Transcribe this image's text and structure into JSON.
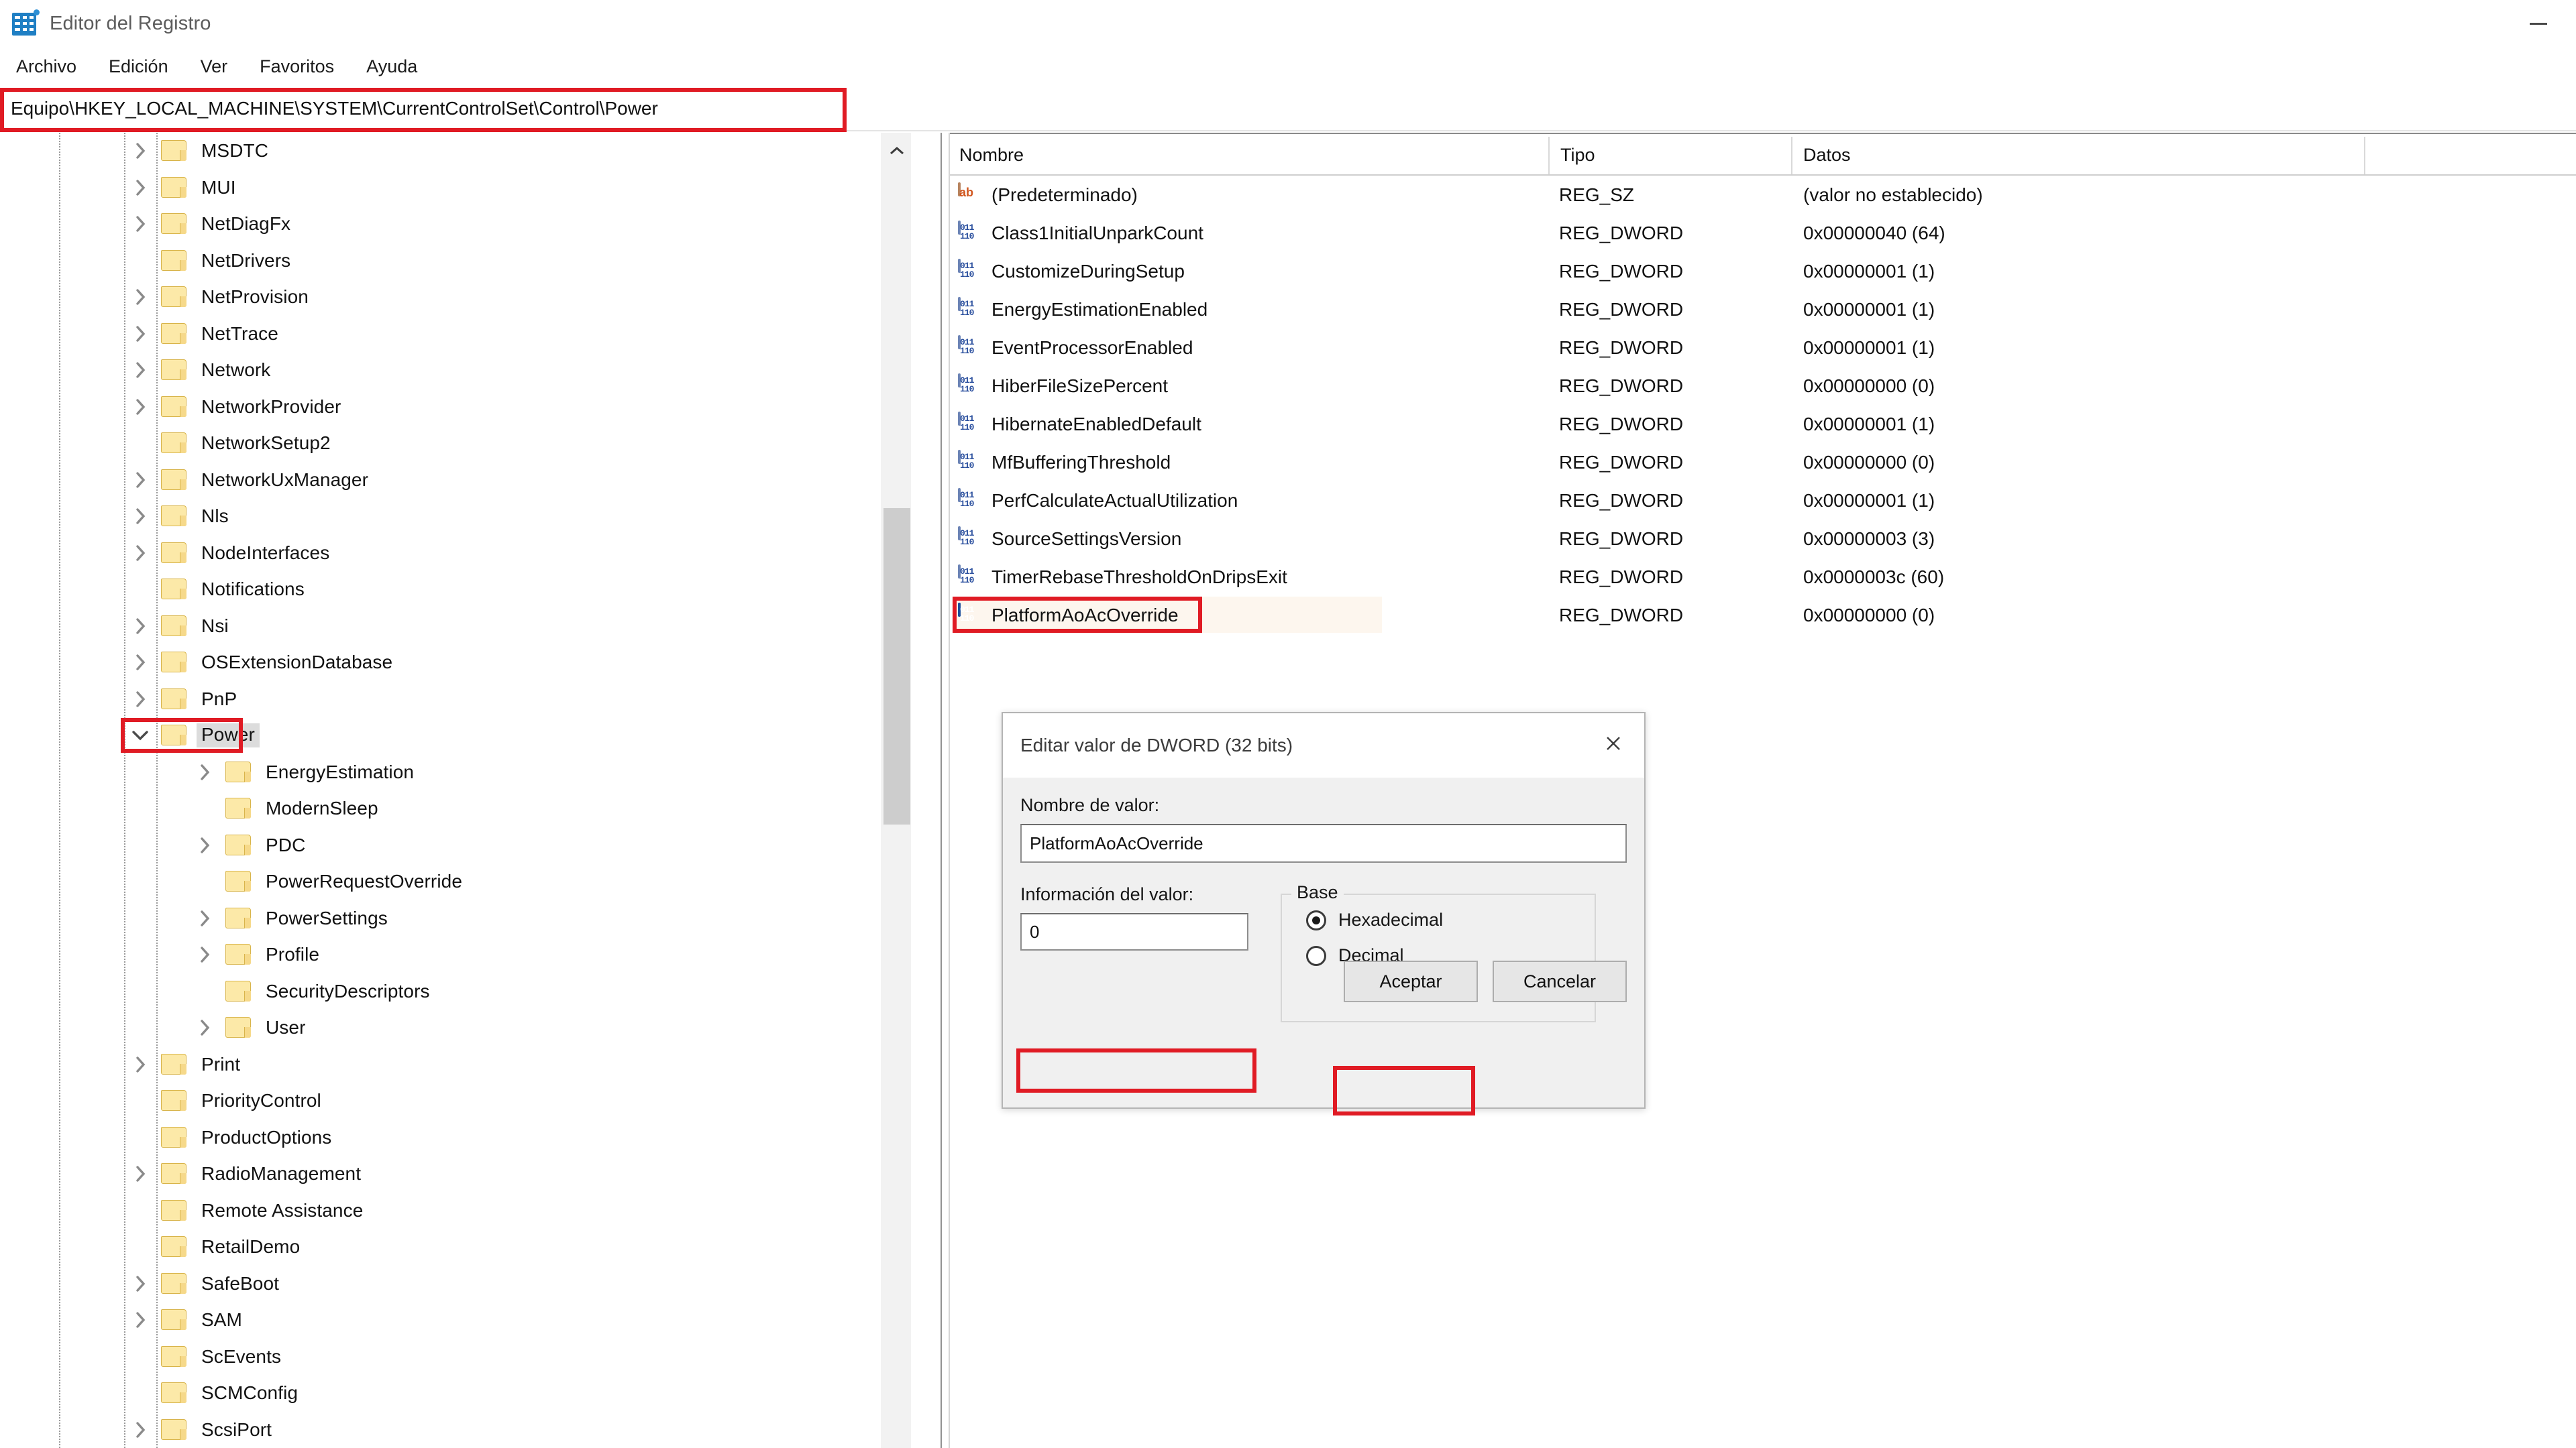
{
  "window": {
    "title": "Editor del Registro",
    "app_icon": "registry-editor-icon",
    "minimize_label": "Minimizar"
  },
  "menubar": {
    "items": [
      {
        "label": "Archivo"
      },
      {
        "label": "Edición"
      },
      {
        "label": "Ver"
      },
      {
        "label": "Favoritos"
      },
      {
        "label": "Ayuda"
      }
    ]
  },
  "address_bar": {
    "value": "Equipo\\HKEY_LOCAL_MACHINE\\SYSTEM\\CurrentControlSet\\Control\\Power",
    "highlighted": true,
    "highlight_color": "#e01b24"
  },
  "tree": {
    "scroll_arrow_up_icon": "chevron-up-icon",
    "nodes": [
      {
        "label": "MSDTC",
        "depth": 1,
        "expandable": true,
        "expanded": false
      },
      {
        "label": "MUI",
        "depth": 1,
        "expandable": true,
        "expanded": false
      },
      {
        "label": "NetDiagFx",
        "depth": 1,
        "expandable": true,
        "expanded": false
      },
      {
        "label": "NetDrivers",
        "depth": 1,
        "expandable": false,
        "expanded": false
      },
      {
        "label": "NetProvision",
        "depth": 1,
        "expandable": true,
        "expanded": false
      },
      {
        "label": "NetTrace",
        "depth": 1,
        "expandable": true,
        "expanded": false
      },
      {
        "label": "Network",
        "depth": 1,
        "expandable": true,
        "expanded": false
      },
      {
        "label": "NetworkProvider",
        "depth": 1,
        "expandable": true,
        "expanded": false
      },
      {
        "label": "NetworkSetup2",
        "depth": 1,
        "expandable": false,
        "expanded": false
      },
      {
        "label": "NetworkUxManager",
        "depth": 1,
        "expandable": true,
        "expanded": false
      },
      {
        "label": "Nls",
        "depth": 1,
        "expandable": true,
        "expanded": false
      },
      {
        "label": "NodeInterfaces",
        "depth": 1,
        "expandable": true,
        "expanded": false
      },
      {
        "label": "Notifications",
        "depth": 1,
        "expandable": false,
        "expanded": false
      },
      {
        "label": "Nsi",
        "depth": 1,
        "expandable": true,
        "expanded": false
      },
      {
        "label": "OSExtensionDatabase",
        "depth": 1,
        "expandable": true,
        "expanded": false
      },
      {
        "label": "PnP",
        "depth": 1,
        "expandable": true,
        "expanded": false
      },
      {
        "label": "Power",
        "depth": 1,
        "expandable": true,
        "expanded": true,
        "selected": true,
        "highlighted": true
      },
      {
        "label": "EnergyEstimation",
        "depth": 2,
        "expandable": true,
        "expanded": false
      },
      {
        "label": "ModernSleep",
        "depth": 2,
        "expandable": false,
        "expanded": false
      },
      {
        "label": "PDC",
        "depth": 2,
        "expandable": true,
        "expanded": false
      },
      {
        "label": "PowerRequestOverride",
        "depth": 2,
        "expandable": false,
        "expanded": false
      },
      {
        "label": "PowerSettings",
        "depth": 2,
        "expandable": true,
        "expanded": false
      },
      {
        "label": "Profile",
        "depth": 2,
        "expandable": true,
        "expanded": false
      },
      {
        "label": "SecurityDescriptors",
        "depth": 2,
        "expandable": false,
        "expanded": false
      },
      {
        "label": "User",
        "depth": 2,
        "expandable": true,
        "expanded": false
      },
      {
        "label": "Print",
        "depth": 1,
        "expandable": true,
        "expanded": false
      },
      {
        "label": "PriorityControl",
        "depth": 1,
        "expandable": false,
        "expanded": false
      },
      {
        "label": "ProductOptions",
        "depth": 1,
        "expandable": false,
        "expanded": false
      },
      {
        "label": "RadioManagement",
        "depth": 1,
        "expandable": true,
        "expanded": false
      },
      {
        "label": "Remote Assistance",
        "depth": 1,
        "expandable": false,
        "expanded": false
      },
      {
        "label": "RetailDemo",
        "depth": 1,
        "expandable": false,
        "expanded": false
      },
      {
        "label": "SafeBoot",
        "depth": 1,
        "expandable": true,
        "expanded": false
      },
      {
        "label": "SAM",
        "depth": 1,
        "expandable": true,
        "expanded": false
      },
      {
        "label": "ScEvents",
        "depth": 1,
        "expandable": false,
        "expanded": false
      },
      {
        "label": "SCMConfig",
        "depth": 1,
        "expandable": false,
        "expanded": false
      },
      {
        "label": "ScsiPort",
        "depth": 1,
        "expandable": true,
        "expanded": false
      }
    ]
  },
  "values": {
    "columns": [
      {
        "label": "Nombre"
      },
      {
        "label": "Tipo"
      },
      {
        "label": "Datos"
      }
    ],
    "rows": [
      {
        "name": "(Predeterminado)",
        "type": "REG_SZ",
        "data": "(valor no establecido)",
        "icon": "string-value-icon"
      },
      {
        "name": "Class1InitialUnparkCount",
        "type": "REG_DWORD",
        "data": "0x00000040 (64)",
        "icon": "dword-value-icon"
      },
      {
        "name": "CustomizeDuringSetup",
        "type": "REG_DWORD",
        "data": "0x00000001 (1)",
        "icon": "dword-value-icon"
      },
      {
        "name": "EnergyEstimationEnabled",
        "type": "REG_DWORD",
        "data": "0x00000001 (1)",
        "icon": "dword-value-icon"
      },
      {
        "name": "EventProcessorEnabled",
        "type": "REG_DWORD",
        "data": "0x00000001 (1)",
        "icon": "dword-value-icon"
      },
      {
        "name": "HiberFileSizePercent",
        "type": "REG_DWORD",
        "data": "0x00000000 (0)",
        "icon": "dword-value-icon"
      },
      {
        "name": "HibernateEnabledDefault",
        "type": "REG_DWORD",
        "data": "0x00000001 (1)",
        "icon": "dword-value-icon"
      },
      {
        "name": "MfBufferingThreshold",
        "type": "REG_DWORD",
        "data": "0x00000000 (0)",
        "icon": "dword-value-icon"
      },
      {
        "name": "PerfCalculateActualUtilization",
        "type": "REG_DWORD",
        "data": "0x00000001 (1)",
        "icon": "dword-value-icon"
      },
      {
        "name": "SourceSettingsVersion",
        "type": "REG_DWORD",
        "data": "0x00000003 (3)",
        "icon": "dword-value-icon"
      },
      {
        "name": "TimerRebaseThresholdOnDripsExit",
        "type": "REG_DWORD",
        "data": "0x0000003c (60)",
        "icon": "dword-value-icon"
      },
      {
        "name": "PlatformAoAcOverride",
        "type": "REG_DWORD",
        "data": "0x00000000 (0)",
        "icon": "dword-value-icon",
        "selected": true,
        "highlighted": true
      }
    ]
  },
  "dialog": {
    "title": "Editar valor de DWORD (32 bits)",
    "close_icon": "close-icon",
    "name_label": "Nombre de valor:",
    "name_value": "PlatformAoAcOverride",
    "data_label": "Información del valor:",
    "data_value": "0",
    "base_legend": "Base",
    "base_options": [
      {
        "label": "Hexadecimal",
        "checked": true
      },
      {
        "label": "Decimal",
        "checked": false
      }
    ],
    "ok_label": "Aceptar",
    "cancel_label": "Cancelar",
    "ok_highlighted": true,
    "data_highlighted": true
  }
}
